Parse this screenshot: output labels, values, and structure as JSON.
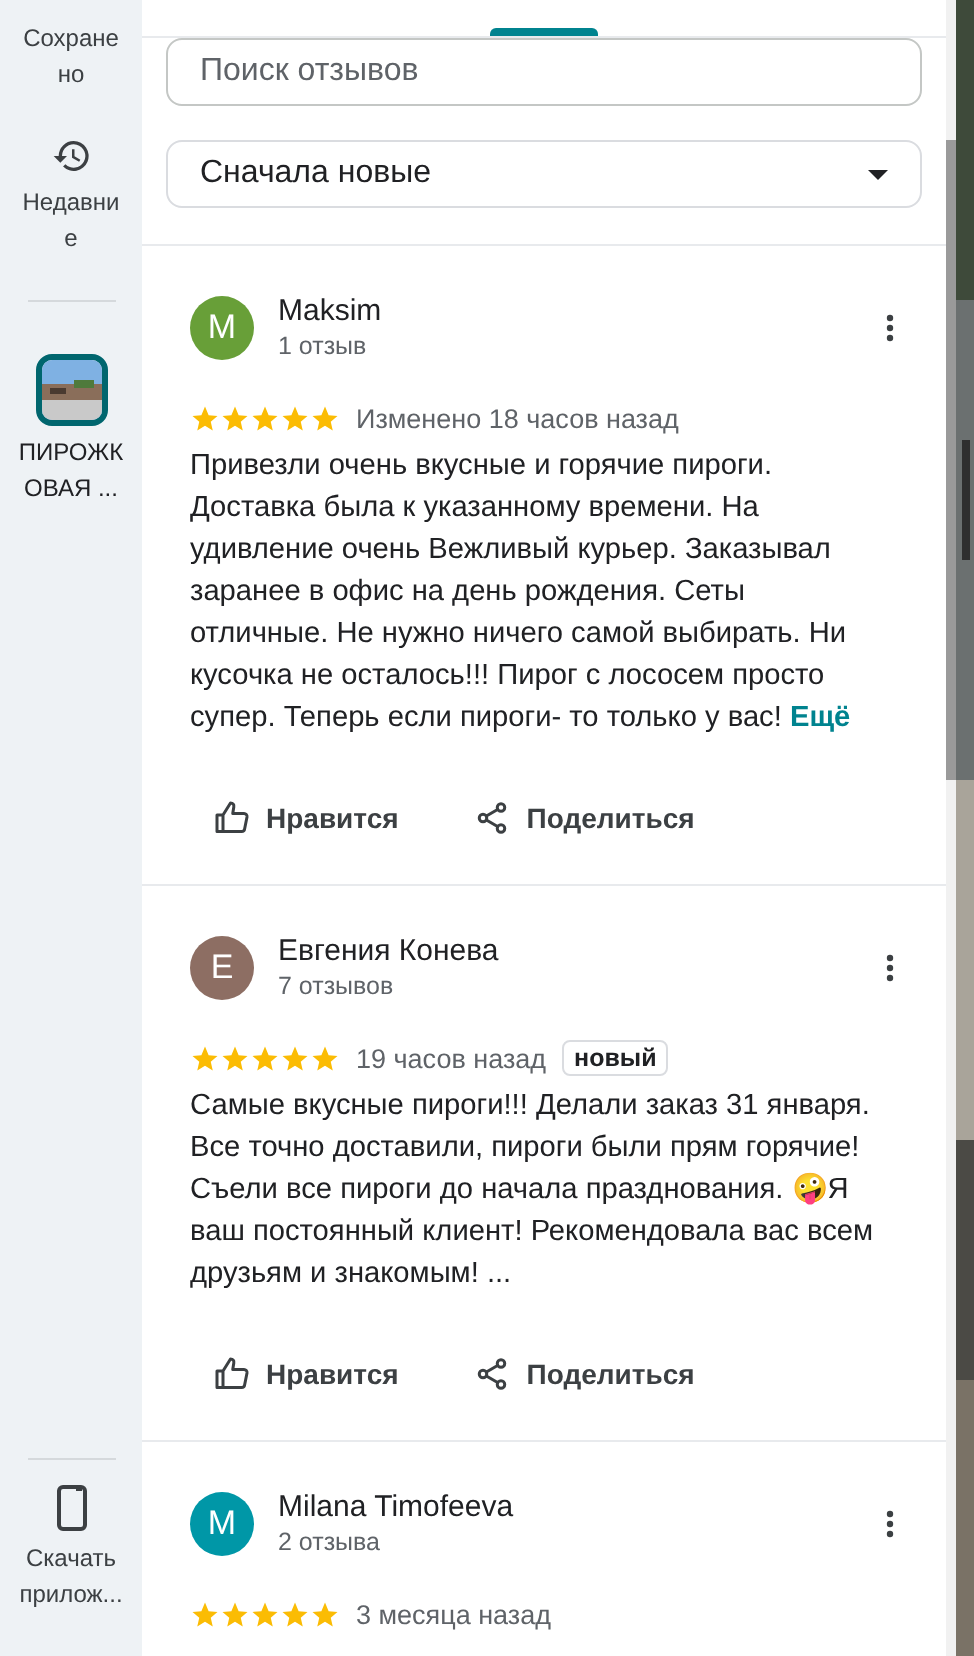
{
  "sidebar": {
    "items": [
      {
        "kind": "saved",
        "label": "Сохранено"
      },
      {
        "kind": "recent",
        "label": "Недавние"
      },
      {
        "kind": "place",
        "label": "ПИРОЖКОВАЯ ...",
        "selected": true
      }
    ],
    "download": {
      "label": "Скачать прилож..."
    }
  },
  "tabs": [
    {
      "selected": false
    },
    {
      "selected": true
    },
    {
      "selected": false
    }
  ],
  "search": {
    "placeholder": "Поиск отзывов"
  },
  "sort": {
    "value": "Сначала новые"
  },
  "reviews": [
    {
      "initial": "M",
      "color": "#689f38",
      "name": "Maksim",
      "count": "1 отзыв",
      "stars": 5,
      "time": "Изменено 18 часов назад",
      "text": "Привезли очень вкусные и горячие пироги. Доставка была к указанному времени.  На удивление очень Вежливый курьер. Заказывал заранее в офис на день рождения. Сеты отличные. Не нужно ничего самой выбирать. Ни кусочка не осталось!!! Пирог с лососем просто супер. Теперь если пироги- то только у вас!",
      "more": "Ещё",
      "actions": [
        "Нравится",
        "Поделиться"
      ]
    },
    {
      "initial": "E",
      "color": "#8d6e63",
      "name": "Евгения Конева",
      "count": "7 отзывов",
      "stars": 5,
      "time": "19 часов назад",
      "badge": "новый",
      "text": "Самые вкусные пироги!!! Делали заказ 31 января. Все точно доставили, пироги были прям горячие! Съели все пироги до начала празднования. 🤪Я ваш постоянный клиент! Рекомендовала вас всем друзьям и знакомым! ...",
      "actions": [
        "Нравится",
        "Поделиться"
      ]
    },
    {
      "initial": "M",
      "color": "#0097a7",
      "name": "Milana Timofeeva",
      "count": "2 отзыва",
      "stars": 5,
      "time": "3 месяца назад"
    }
  ]
}
